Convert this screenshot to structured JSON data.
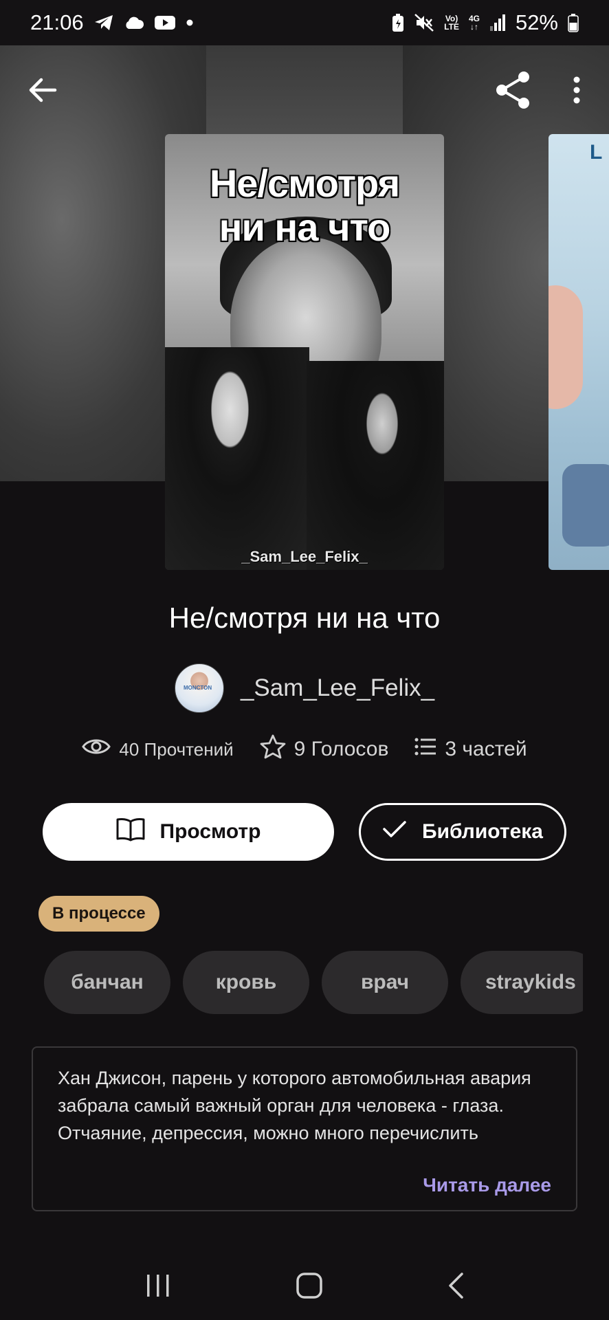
{
  "status_bar": {
    "time": "21:06",
    "battery": "52%",
    "network_top": "Vo)",
    "network_bottom": "LTE",
    "network_type": "4G",
    "left_icons": [
      "telegram-icon",
      "cloud-icon",
      "youtube-icon",
      "dot-icon"
    ],
    "right_icons": [
      "battery-saver-icon",
      "mute-icon",
      "volte-icon",
      "4g-icon",
      "signal-icon",
      "battery-icon"
    ]
  },
  "top_bar": {
    "back_icon": "back-arrow-icon",
    "share_icon": "share-icon",
    "more_icon": "more-vertical-icon"
  },
  "cover": {
    "title_text": "Не/смотря\nни на что",
    "author_text": "_Sam_Lee_Felix_",
    "next_cover_text": "L"
  },
  "book": {
    "title": "Не/смотря ни на что",
    "author": "_Sam_Lee_Felix_",
    "avatar_text": "MONCTON"
  },
  "stats": {
    "reads": "40 Прочтений",
    "votes": "9 Голосов",
    "parts": "3 частей"
  },
  "actions": {
    "read_label": "Просмотр",
    "library_label": "Библиотека"
  },
  "status_badge": "В процессе",
  "tags": [
    "банчан",
    "кровь",
    "врач",
    "straykids"
  ],
  "description": {
    "text": "Хан Джисон, парень у которого автомобильная авария забрала самый важный орган для человека - глаза.\nОтчаяние, депрессия, можно много перечислить",
    "read_more": "Читать далее"
  },
  "colors": {
    "background": "#121012",
    "badge": "#d9b27a",
    "read_more": "#a99ae8",
    "chip": "#2c2a2c"
  },
  "nav_bar": [
    "recents-icon",
    "home-icon",
    "back-icon"
  ]
}
